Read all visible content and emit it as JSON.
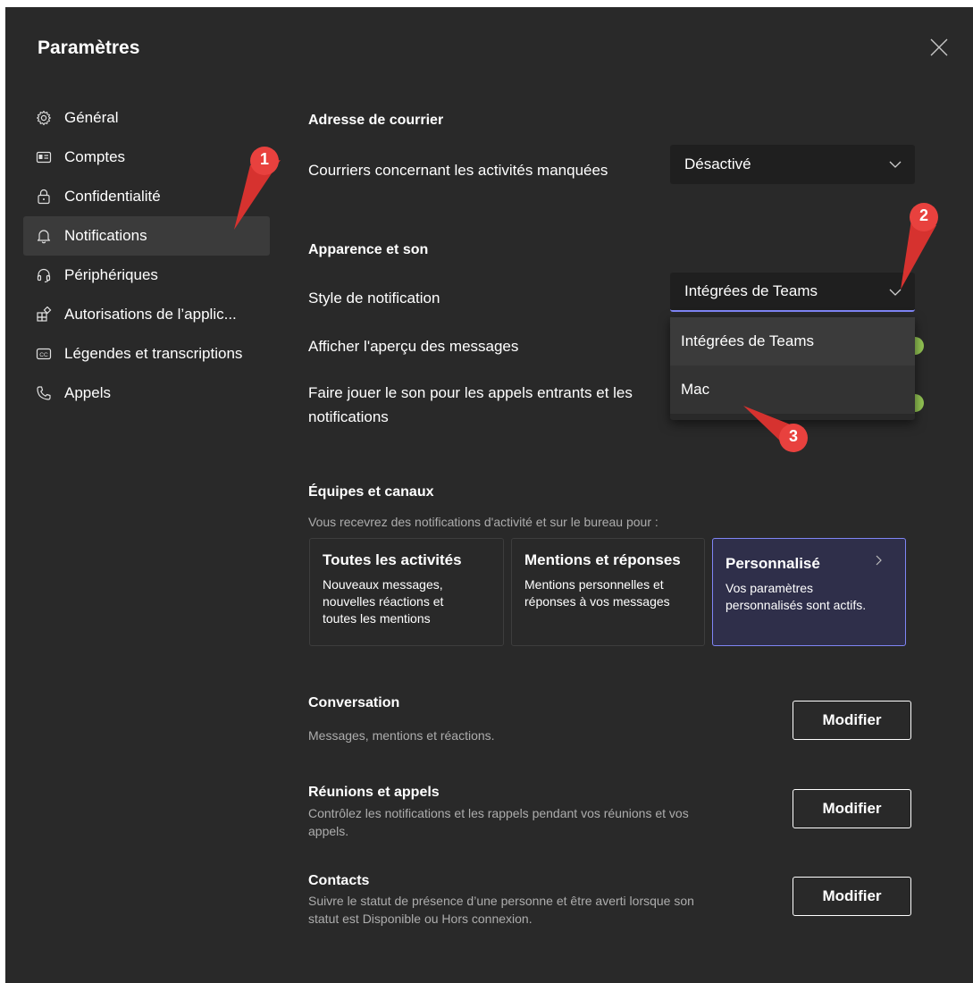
{
  "dialog": {
    "title": "Paramètres"
  },
  "nav": {
    "items": [
      {
        "label": "Général",
        "icon": "gear-icon"
      },
      {
        "label": "Comptes",
        "icon": "id-card-icon"
      },
      {
        "label": "Confidentialité",
        "icon": "lock-icon"
      },
      {
        "label": "Notifications",
        "icon": "bell-icon",
        "active": true
      },
      {
        "label": "Périphériques",
        "icon": "headset-icon"
      },
      {
        "label": "Autorisations de l’applic...",
        "icon": "app-permissions-icon"
      },
      {
        "label": "Légendes et transcriptions",
        "icon": "captions-icon"
      },
      {
        "label": "Appels",
        "icon": "phone-icon"
      }
    ]
  },
  "email": {
    "heading": "Adresse de courrier",
    "missed_label": "Courriers concernant les activités manquées",
    "missed_value": "Désactivé"
  },
  "appearance": {
    "heading": "Apparence et son",
    "style_label": "Style de notification",
    "style_value": "Intégrées de Teams",
    "preview_label": "Afficher l'aperçu des messages",
    "sound_label_line1": "Faire jouer le son pour les appels entrants et les",
    "sound_label_line2": "notifications",
    "dropdown_options": [
      "Intégrées de Teams",
      "Mac"
    ]
  },
  "teams": {
    "heading": "Équipes et canaux",
    "subtitle": "Vous recevrez des notifications d'activité et sur le bureau pour :",
    "cards": [
      {
        "title": "Toutes les activités",
        "line1": "Nouveaux messages,",
        "line2": "nouvelles réactions et",
        "line3": "toutes les mentions"
      },
      {
        "title": "Mentions et réponses",
        "line1": "Mentions personnelles et",
        "line2": "réponses à vos messages",
        "line3": ""
      },
      {
        "title": "Personnalisé",
        "line1": "Vos paramètres",
        "line2": "personnalisés sont actifs.",
        "line3": ""
      }
    ]
  },
  "conversation": {
    "heading": "Conversation",
    "subtitle": "Messages, mentions et réactions.",
    "button": "Modifier"
  },
  "meetings": {
    "heading": "Réunions et appels",
    "subtitle_line1": "Contrôlez les notifications et les rappels pendant vos réunions et vos",
    "subtitle_line2": "appels.",
    "button": "Modifier"
  },
  "contacts": {
    "heading": "Contacts",
    "subtitle_line1": "Suivre le statut de présence d’une personne et être averti lorsque son",
    "subtitle_line2": "statut est Disponible ou Hors connexion.",
    "button": "Modifier"
  },
  "markers": [
    "1",
    "2",
    "3"
  ],
  "colors": {
    "background": "#292929",
    "accent": "#7f85f5",
    "marker_red": "#e8413e",
    "toggle_on": "#92c353"
  }
}
